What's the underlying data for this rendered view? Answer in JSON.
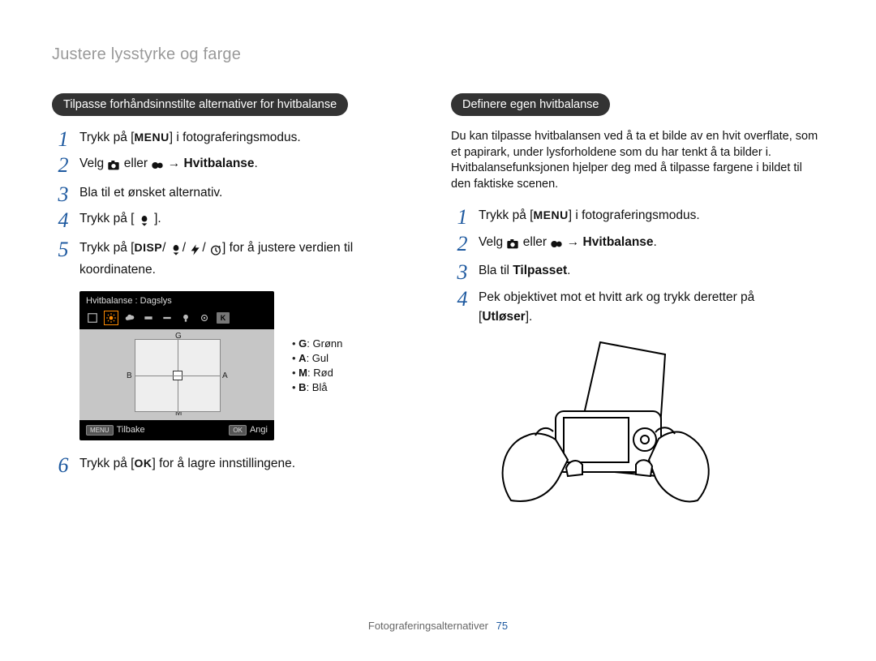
{
  "page_title": "Justere lysstyrke og farge",
  "footer": {
    "section": "Fotograferingsalternativer",
    "page": "75"
  },
  "buttons": {
    "menu": "MENU",
    "disp": "DISP",
    "ok": "OK"
  },
  "icons": {
    "camera": "camera-icon",
    "video": "video-icon",
    "flower_down": "macro-down-icon",
    "flash": "flash-icon",
    "timer": "timer-icon"
  },
  "left": {
    "heading": "Tilpasse forhåndsinnstilte alternativer for hvitbalanse",
    "steps": {
      "s1a": "Trykk på [",
      "s1b": "] i fotograferingsmodus.",
      "s2a": "Velg ",
      "s2b": " eller ",
      "s2c": " → ",
      "s2d": "Hvitbalanse",
      "s2e": ".",
      "s3": "Bla til et ønsket alternativ.",
      "s4a": "Trykk på [",
      "s4b": "].",
      "s5a": "Trykk på [",
      "s5b": "/",
      "s5c": "/",
      "s5d": "/",
      "s5e": "] for å justere verdien til",
      "s5f": "koordinatene.",
      "s6a": "Trykk på [",
      "s6b": "] for å lagre innstillingene."
    },
    "lcd": {
      "title": "Hvitbalanse : Dagslys",
      "axes": {
        "G": "G",
        "A": "A",
        "M": "M",
        "B": "B"
      },
      "kelvin": "K",
      "back_btn": "MENU",
      "back_label": "Tilbake",
      "set_btn": "OK",
      "set_label": "Angi"
    },
    "legend": {
      "G_key": "G",
      "G_val": ": Grønn",
      "A_key": "A",
      "A_val": ": Gul",
      "M_key": "M",
      "M_val": ": Rød",
      "B_key": "B",
      "B_val": ": Blå"
    }
  },
  "right": {
    "heading": "Definere egen hvitbalanse",
    "intro": "Du kan tilpasse hvitbalansen ved å ta et bilde av en hvit overflate, som et papirark, under lysforholdene som du har tenkt å ta bilder i. Hvitbalansefunksjonen hjelper deg med å tilpasse fargene i bildet til den faktiske scenen.",
    "steps": {
      "s1a": "Trykk på [",
      "s1b": "] i fotograferingsmodus.",
      "s2a": "Velg ",
      "s2b": " eller ",
      "s2c": " → ",
      "s2d": "Hvitbalanse",
      "s2e": ".",
      "s3a": "Bla til ",
      "s3b": "Tilpasset",
      "s3c": ".",
      "s4a": "Pek objektivet mot et hvitt ark og trykk deretter på",
      "s4b": "[",
      "s4c": "Utløser",
      "s4d": "]."
    }
  }
}
